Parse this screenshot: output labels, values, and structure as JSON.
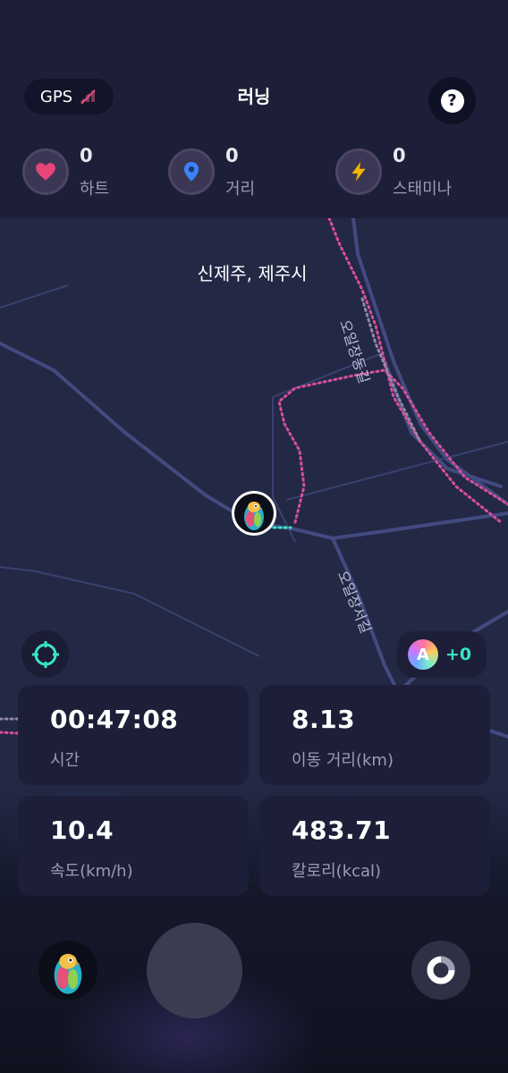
{
  "header": {
    "gps_label": "GPS",
    "title": "러닝",
    "help_label": "?"
  },
  "stats": {
    "heart": {
      "value": "0",
      "label": "하트"
    },
    "distance": {
      "value": "0",
      "label": "거리"
    },
    "stamina": {
      "value": "0",
      "label": "스태미나"
    }
  },
  "map": {
    "location": "신제주, 제주시",
    "road_north": "오일장동길",
    "road_south": "오일장서길"
  },
  "bonus": {
    "badge": "A",
    "value": "+0"
  },
  "metrics": {
    "time": {
      "value": "00:47:08",
      "label": "시간"
    },
    "distance": {
      "value": "8.13",
      "label": "이동 거리(km)"
    },
    "speed": {
      "value": "10.4",
      "label": "속도(km/h)"
    },
    "calories": {
      "value": "483.71",
      "label": "칼로리(kcal)"
    }
  },
  "colors": {
    "header_bg": "#1c1f37",
    "map_bg": "#232845",
    "heart": "#e8457a",
    "location_pin": "#3b82f6",
    "stamina": "#f4b400",
    "route_pink": "#d94f9b",
    "route_teal": "#39e4c4"
  },
  "icons": {
    "gps_status": "gps-off-icon",
    "help": "question-icon",
    "heart": "heart-icon",
    "distance": "location-pin-icon",
    "stamina": "lightning-icon",
    "recenter": "crosshair-icon",
    "stats": "donut-chart-icon"
  }
}
